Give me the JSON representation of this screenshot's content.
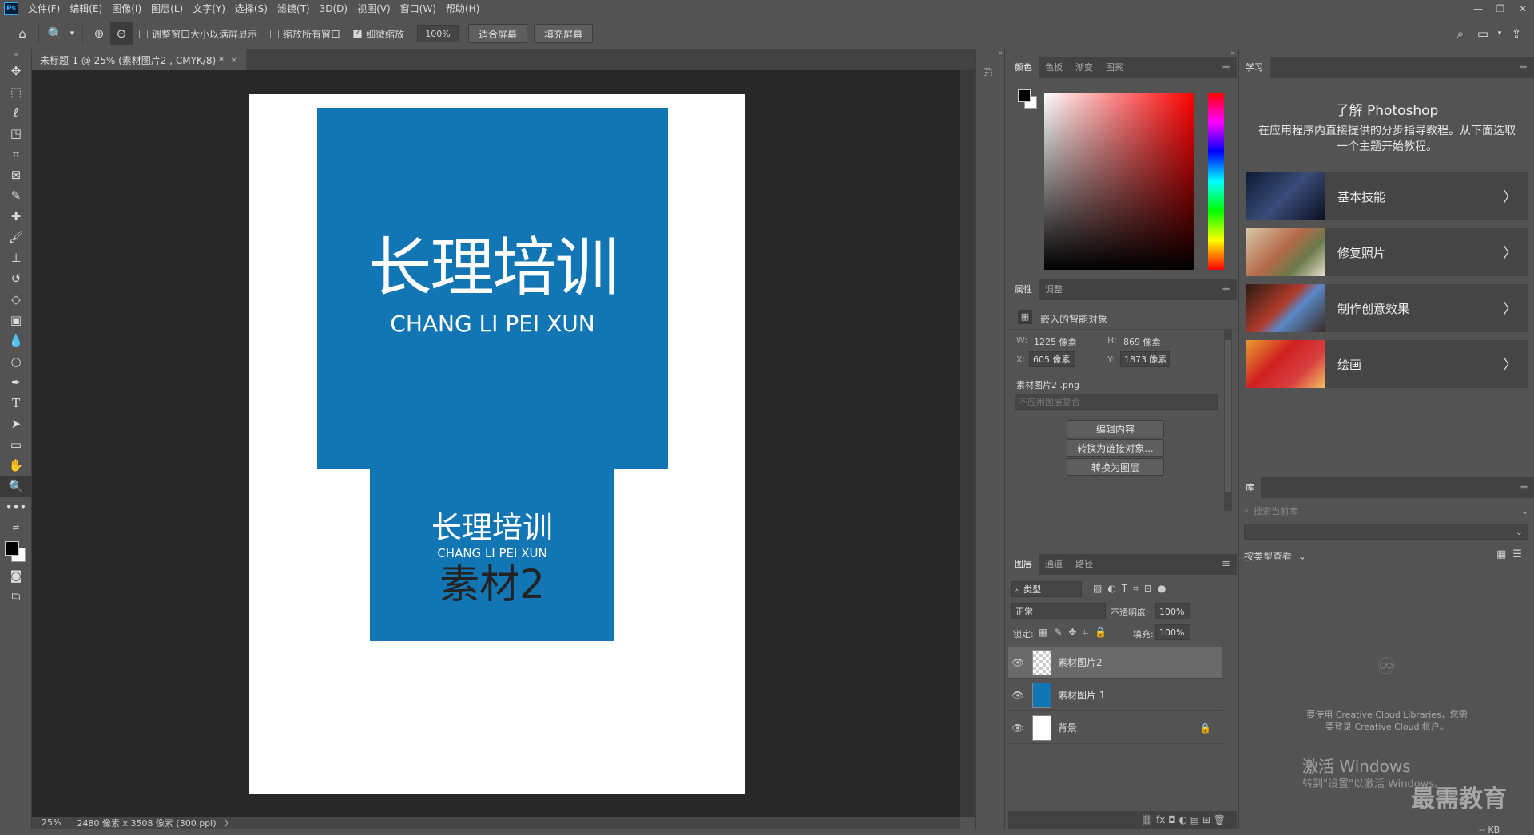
{
  "app": {
    "logo": "Ps"
  },
  "menu": [
    "文件(F)",
    "编辑(E)",
    "图像(I)",
    "图层(L)",
    "文字(Y)",
    "选择(S)",
    "滤镜(T)",
    "3D(D)",
    "视图(V)",
    "窗口(W)",
    "帮助(H)"
  ],
  "window_controls": {
    "minimize": "—",
    "restore": "❐",
    "close": "✕"
  },
  "options": {
    "resize_windows": "调整窗口大小以满屏显示",
    "zoom_all": "缩放所有窗口",
    "scrubby_zoom": "细微缩放",
    "zoom_value": "100%",
    "fit_screen": "适合屏幕",
    "fill_screen": "填充屏幕"
  },
  "document": {
    "tab_title": "未标题-1 @ 25% (素材图片2 , CMYK/8) *",
    "tab_close": "×",
    "zoom": "25%",
    "info": "2480 像素 x 3508 像素 (300 ppi)",
    "info_arrow": "〉"
  },
  "canvas": {
    "big_title": "长理培训",
    "big_subtitle": "CHANG LI PEI XUN",
    "small_title": "长理培训",
    "small_subtitle": "CHANG LI PEI XUN",
    "small_label": "素材2",
    "blue": "#1275b4"
  },
  "color_panel": {
    "tabs": [
      "颜色",
      "色板",
      "渐变",
      "图案"
    ]
  },
  "properties": {
    "tabs": [
      "属性",
      "调整"
    ],
    "object_type": "嵌入的智能对象",
    "w_label": "W:",
    "w_value": "1225 像素",
    "h_label": "H:",
    "h_value": "869 像素",
    "x_label": "X:",
    "x_value": "605 像素",
    "y_label": "Y:",
    "y_value": "1873 像素",
    "filename": "素材图片2 .png",
    "comp_placeholder": "不应用图层复合",
    "edit_contents": "编辑内容",
    "convert_linked": "转换为链接对象...",
    "convert_layer": "转换为图层"
  },
  "layers_panel": {
    "tabs": [
      "图层",
      "通道",
      "路径"
    ],
    "filter_type": "类型",
    "blend_mode": "正常",
    "opacity_label": "不透明度:",
    "opacity_value": "100%",
    "lock_label": "锁定:",
    "fill_label": "填充:",
    "fill_value": "100%",
    "layers": [
      {
        "name": "素材图片2"
      },
      {
        "name": "素材图片 1"
      },
      {
        "name": "背景"
      }
    ],
    "footer_icons": "⛓  fx  ◘  ◐  ▤  ⊞  🗑"
  },
  "learn_panel": {
    "tab": "学习",
    "title": "了解 Photoshop",
    "desc": "在应用程序内直接提供的分步指导教程。从下面选取一个主题开始教程。",
    "items": [
      {
        "label": "基本技能"
      },
      {
        "label": "修复照片"
      },
      {
        "label": "制作创意效果"
      },
      {
        "label": "绘画"
      }
    ]
  },
  "library_panel": {
    "tab": "库",
    "search_placeholder": "搜索当前库",
    "view_by": "按类型查看",
    "message": "要使用 Creative Cloud Libraries，您需要登录 Creative Cloud 帐户。",
    "kb": "-- KB"
  },
  "overlay": {
    "activate_title": "激活 Windows",
    "activate_sub": "转到\"设置\"以激活 Windows。",
    "watermark": "最需教育"
  }
}
